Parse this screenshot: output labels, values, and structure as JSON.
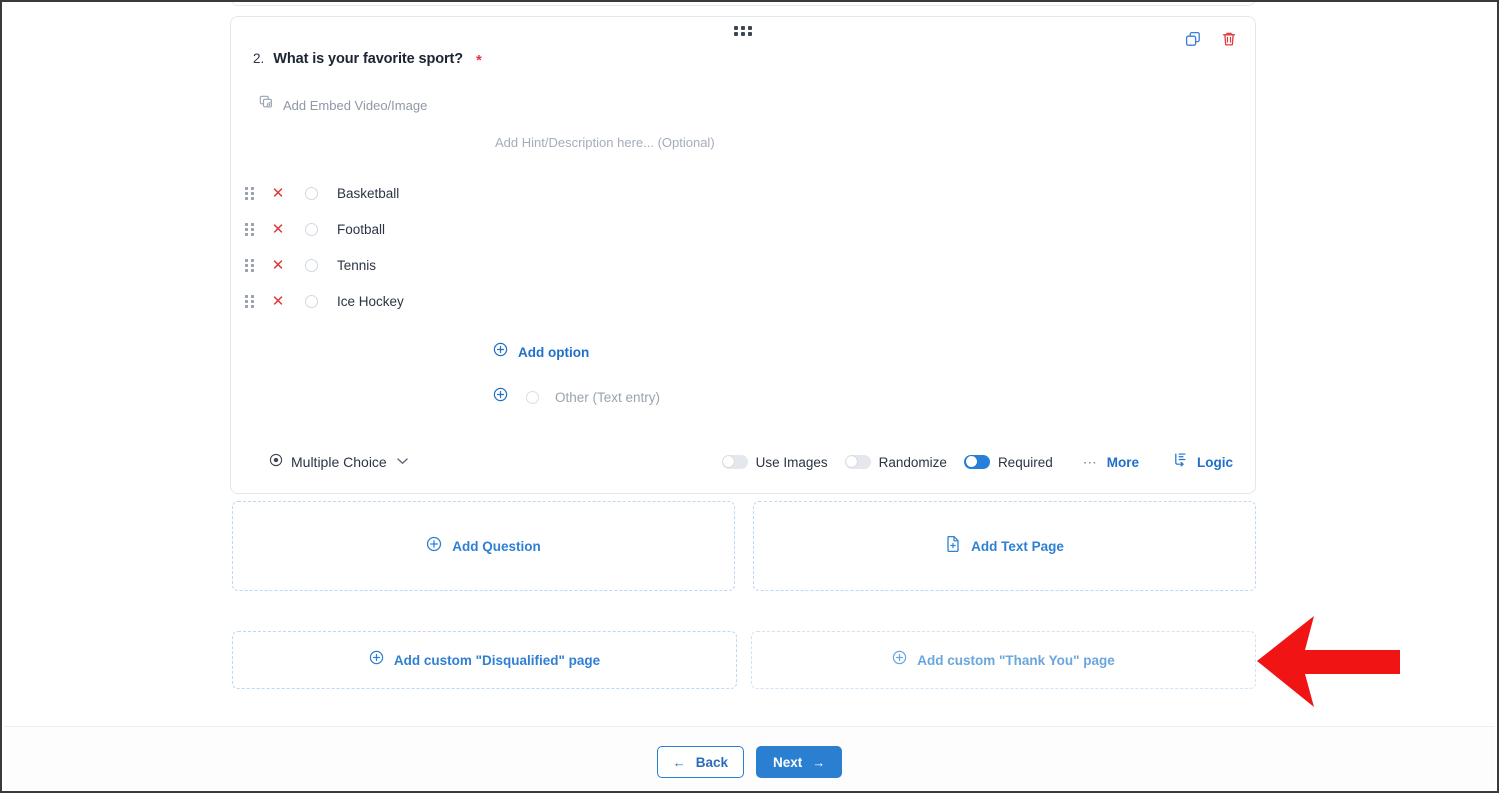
{
  "question": {
    "number": "2.",
    "title": "What is your favorite sport?",
    "required_marker": "*",
    "embed_label": "Add Embed Video/Image",
    "embed_icon": "add-media-icon",
    "hint_placeholder": "Add Hint/Description here... (Optional)",
    "drag_handle_icon": "drag-handle-icon",
    "duplicate_icon": "duplicate-icon",
    "delete_icon": "trash-icon",
    "options": [
      {
        "label": "Basketball",
        "remove_icon": "remove-x-icon",
        "drag_icon": "drag-dots-icon",
        "selected": false
      },
      {
        "label": "Football",
        "remove_icon": "remove-x-icon",
        "drag_icon": "drag-dots-icon",
        "selected": false
      },
      {
        "label": "Tennis",
        "remove_icon": "remove-x-icon",
        "drag_icon": "drag-dots-icon",
        "selected": false
      },
      {
        "label": "Ice Hockey",
        "remove_icon": "remove-x-icon",
        "drag_icon": "drag-dots-icon",
        "selected": false
      }
    ],
    "remove_glyph": "✕",
    "add_option_label": "Add option",
    "add_option_icon": "plus-circle-icon",
    "other_label": "Other (Text entry)",
    "other_icon": "plus-circle-icon",
    "toolbar": {
      "type_label": "Multiple Choice",
      "type_icon": "radio-circle-icon",
      "type_chevron": "chevron-down-icon",
      "toggles": [
        {
          "label": "Use Images",
          "on": false
        },
        {
          "label": "Randomize",
          "on": false
        },
        {
          "label": "Required",
          "on": true
        }
      ],
      "more_label": "More",
      "more_icon": "ellipsis-icon",
      "more_glyph": "⋯",
      "logic_label": "Logic",
      "logic_icon": "logic-branch-icon"
    }
  },
  "add_buttons": [
    {
      "label": "Add Question",
      "icon": "plus-circle-icon"
    },
    {
      "label": "Add Text Page",
      "icon": "text-page-icon"
    }
  ],
  "custom_page_buttons": [
    {
      "label": "Add custom \"Disqualified\" page",
      "icon": "plus-circle-icon"
    },
    {
      "label": "Add custom \"Thank You\" page",
      "icon": "plus-circle-icon"
    }
  ],
  "footer": {
    "back_label": "Back",
    "back_icon": "arrow-left-icon",
    "back_glyph": "←",
    "next_label": "Next",
    "next_icon": "arrow-right-icon",
    "next_glyph": "→"
  },
  "annotation": {
    "name": "red-pointer-arrow",
    "direction": "left",
    "color": "#f01414"
  },
  "colors": {
    "accent_blue": "#2b7fd0",
    "link_blue": "#2070c9",
    "toggle_on": "#2680d9",
    "danger_red": "#d93a3a",
    "arrow_red": "#f01414",
    "card_border": "#e2e8f0",
    "dashed_border": "#bcd8f2",
    "muted_text": "#9aa3b0"
  }
}
